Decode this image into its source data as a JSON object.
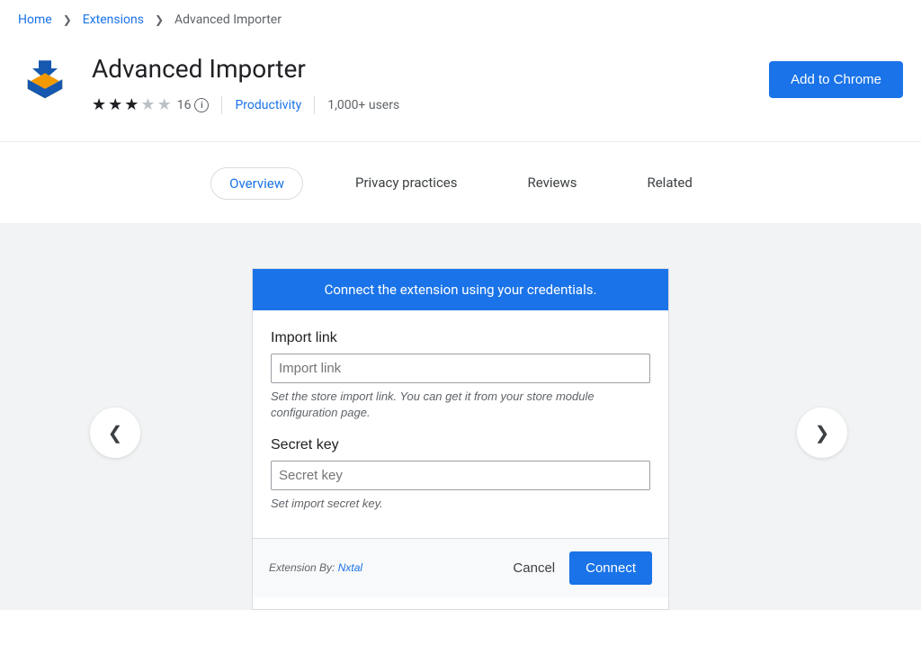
{
  "breadcrumb": {
    "home": "Home",
    "extensions": "Extensions",
    "current": "Advanced Importer"
  },
  "header": {
    "title": "Advanced Importer",
    "rating_count": "16",
    "category": "Productivity",
    "users": "1,000+ users",
    "add_button": "Add to Chrome"
  },
  "tabs": {
    "overview": "Overview",
    "privacy": "Privacy practices",
    "reviews": "Reviews",
    "related": "Related"
  },
  "screenshot": {
    "banner": "Connect the extension using your credentials.",
    "import_label": "Import link",
    "import_placeholder": "Import link",
    "import_hint": "Set the store import link. You can get it from your store module configuration page.",
    "secret_label": "Secret key",
    "secret_placeholder": "Secret key",
    "secret_hint": "Set import secret key.",
    "ext_by_label": "Extension By: ",
    "ext_by_name": "Nxtal",
    "cancel": "Cancel",
    "connect": "Connect"
  }
}
